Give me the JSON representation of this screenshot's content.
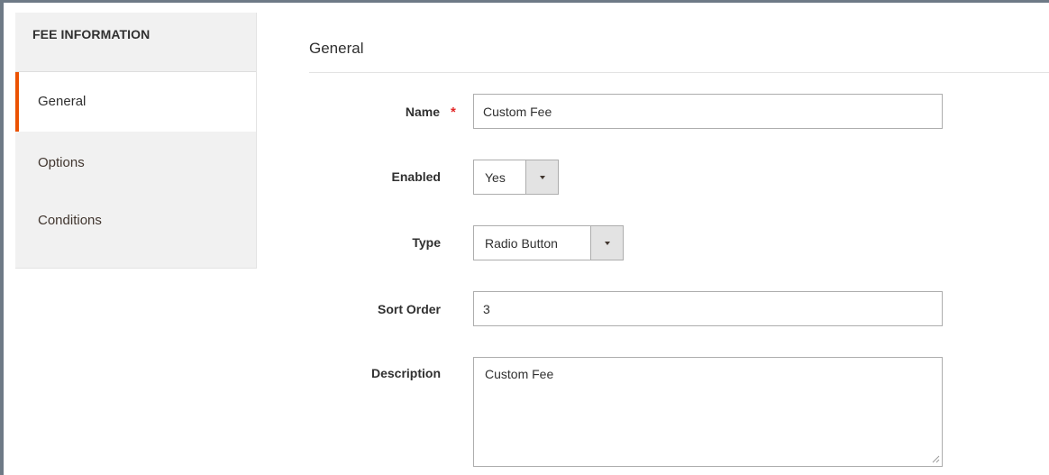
{
  "sidebar": {
    "title": "FEE INFORMATION",
    "items": [
      {
        "label": "General"
      },
      {
        "label": "Options"
      },
      {
        "label": "Conditions"
      }
    ]
  },
  "main": {
    "section_title": "General",
    "fields": {
      "name": {
        "label": "Name",
        "value": "Custom Fee",
        "required_mark": "*"
      },
      "enabled": {
        "label": "Enabled",
        "value": "Yes"
      },
      "type": {
        "label": "Type",
        "value": "Radio Button"
      },
      "sort_order": {
        "label": "Sort Order",
        "value": "3"
      },
      "description": {
        "label": "Description",
        "value": "Custom Fee"
      }
    }
  },
  "colors": {
    "accent": "#eb5202",
    "required": "#e22626",
    "sidebar_bg": "#f1f1f1",
    "frame": "#6e7a86"
  },
  "icons": {
    "dropdown": "chevron-down-icon",
    "resize": "resize-grip-icon"
  }
}
